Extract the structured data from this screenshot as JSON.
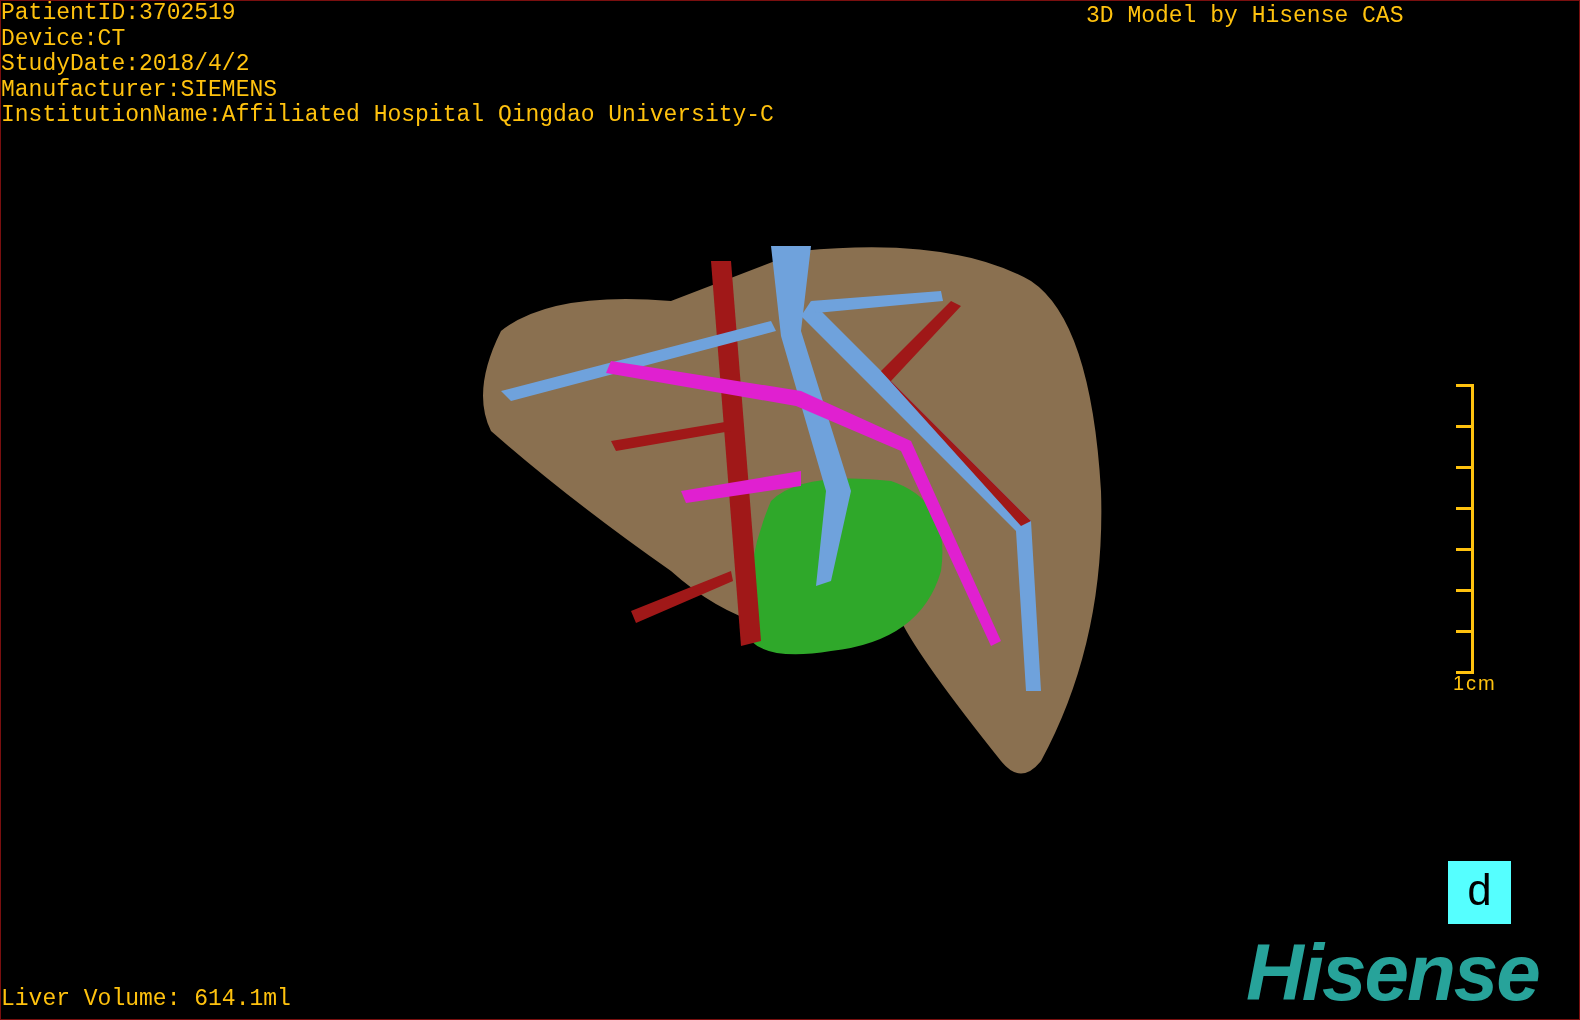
{
  "info_lines": [
    "PatientID:3702519",
    "Device:CT",
    "StudyDate:2018/4/2",
    "Manufacturer:SIEMENS",
    "InstitutionName:Affiliated Hospital Qingdao University-C"
  ],
  "model_title": "3D Model by Hisense CAS",
  "scale_bar": {
    "label": "1cm"
  },
  "view_button": {
    "label": "d"
  },
  "logo": "Hisense",
  "liver_volume": "Liver Volume: 614.1ml"
}
